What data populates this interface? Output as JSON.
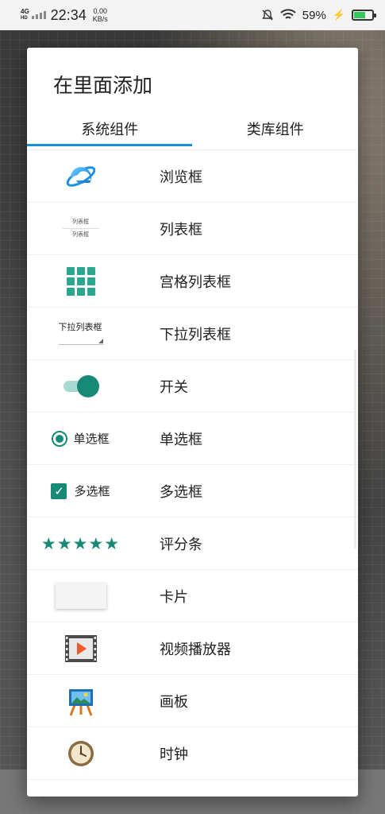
{
  "status_bar": {
    "network": "4G",
    "network_sub": "HD",
    "time": "22:34",
    "speed_value": "0.00",
    "speed_unit": "KB/s",
    "battery": "59%",
    "battery_level": 0.59
  },
  "dialog": {
    "title": "在里面添加",
    "tabs": [
      {
        "label": "系统组件",
        "active": true
      },
      {
        "label": "类库组件",
        "active": false
      }
    ],
    "accent_color": "#1b8fd4",
    "icon_color": "#168a76",
    "items": [
      {
        "label": "浏览框",
        "icon": "ie-browser-icon"
      },
      {
        "label": "列表框",
        "icon": "listbox-icon",
        "icon_texts": [
          "列表框",
          "列表框"
        ]
      },
      {
        "label": "宫格列表框",
        "icon": "grid-list-icon"
      },
      {
        "label": "下拉列表框",
        "icon": "dropdown-icon",
        "icon_text": "下拉列表框"
      },
      {
        "label": "开关",
        "icon": "switch-icon",
        "switch_on": true
      },
      {
        "label": "单选框",
        "icon": "radio-icon",
        "icon_text": "单选框"
      },
      {
        "label": "多选框",
        "icon": "checkbox-icon",
        "icon_text": "多选框"
      },
      {
        "label": "评分条",
        "icon": "rating-stars-icon",
        "rating": 5,
        "icon_text": "★★★★★"
      },
      {
        "label": "卡片",
        "icon": "card-icon"
      },
      {
        "label": "视频播放器",
        "icon": "video-player-icon"
      },
      {
        "label": "画板",
        "icon": "easel-icon"
      },
      {
        "label": "时钟",
        "icon": "clock-icon"
      }
    ]
  }
}
